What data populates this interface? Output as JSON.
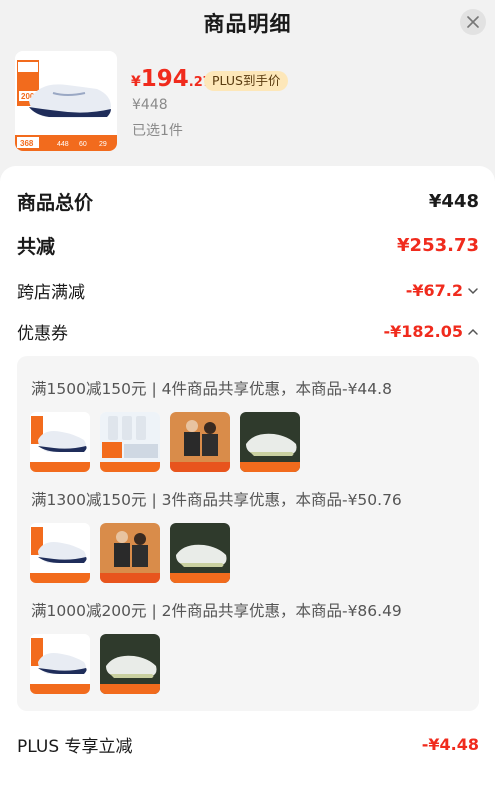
{
  "header": {
    "title": "商品明细",
    "close_icon": "close-icon"
  },
  "product": {
    "price_currency": "¥",
    "price_integer": "194",
    "price_decimal": ".27",
    "plus_tag": "PLUS到手价",
    "original_price": "¥448",
    "selected_count": "已选1件",
    "thumb_texts": [
      "200",
      "368",
      "448",
      "60",
      "29"
    ]
  },
  "summary": {
    "total_label": "商品总价",
    "total_value": "¥448",
    "discount_label": "共减",
    "discount_value": "¥253.73",
    "cross_store_label": "跨店满减",
    "cross_store_value": "-¥67.2",
    "coupon_label": "优惠券",
    "coupon_value": "-¥182.05",
    "plus_label": "PLUS 专享立减",
    "plus_value": "-¥4.48"
  },
  "coupons": [
    {
      "text": "满1500减150元 | 4件商品共享优惠，本商品-¥44.8",
      "thumbs": [
        "shoe-blue",
        "gadget",
        "people",
        "shoe-green"
      ]
    },
    {
      "text": "满1300减150元 | 3件商品共享优惠，本商品-¥50.76",
      "thumbs": [
        "shoe-blue",
        "people",
        "shoe-green"
      ]
    },
    {
      "text": "满1000减200元 | 2件商品共享优惠，本商品-¥86.49",
      "thumbs": [
        "shoe-blue",
        "shoe-green"
      ]
    }
  ],
  "colors": {
    "accent_red": "#f02b1d",
    "plus_gold": "#fde7b9",
    "orange_banner": "#f26b1d"
  }
}
